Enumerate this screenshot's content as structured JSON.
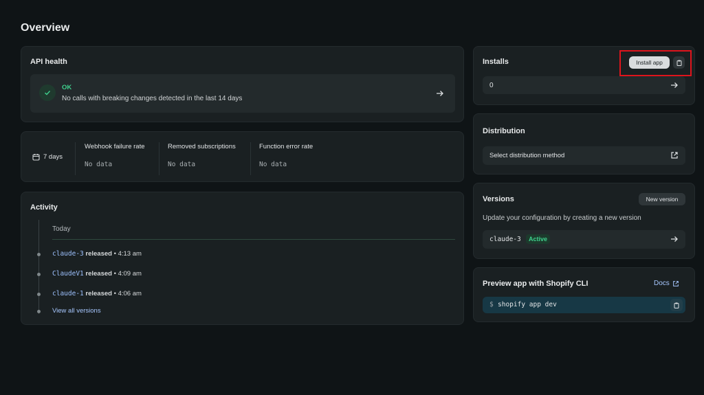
{
  "page": {
    "title": "Overview"
  },
  "api_health": {
    "heading": "API health",
    "status": "OK",
    "message": "No calls with breaking changes detected in the last 14 days"
  },
  "metrics": {
    "period": "7 days",
    "items": [
      {
        "title": "Webhook failure rate",
        "value": "No data"
      },
      {
        "title": "Removed subscriptions",
        "value": "No data"
      },
      {
        "title": "Function error rate",
        "value": "No data"
      }
    ]
  },
  "activity": {
    "heading": "Activity",
    "group": "Today",
    "entries": [
      {
        "version": "claude-3",
        "action": "released",
        "sep": "•",
        "time": "4:13 am"
      },
      {
        "version": "ClaudeV1",
        "action": "released",
        "sep": "•",
        "time": "4:09 am"
      },
      {
        "version": "claude-1",
        "action": "released",
        "sep": "•",
        "time": "4:06 am"
      }
    ],
    "view_all": "View all versions"
  },
  "installs": {
    "heading": "Installs",
    "install_button": "Install app",
    "count": "0"
  },
  "distribution": {
    "heading": "Distribution",
    "select_label": "Select distribution method"
  },
  "versions": {
    "heading": "Versions",
    "new_button": "New version",
    "description": "Update your configuration by creating a new version",
    "current": "claude-3",
    "badge": "Active"
  },
  "preview": {
    "heading": "Preview app with Shopify CLI",
    "docs": "Docs",
    "prompt": "$",
    "command": "shopify app dev"
  },
  "colors": {
    "background": "#0f1416",
    "card": "#1a2022",
    "success": "#3fd08d",
    "link": "#a7c7ff",
    "highlight": "#e0141c"
  }
}
